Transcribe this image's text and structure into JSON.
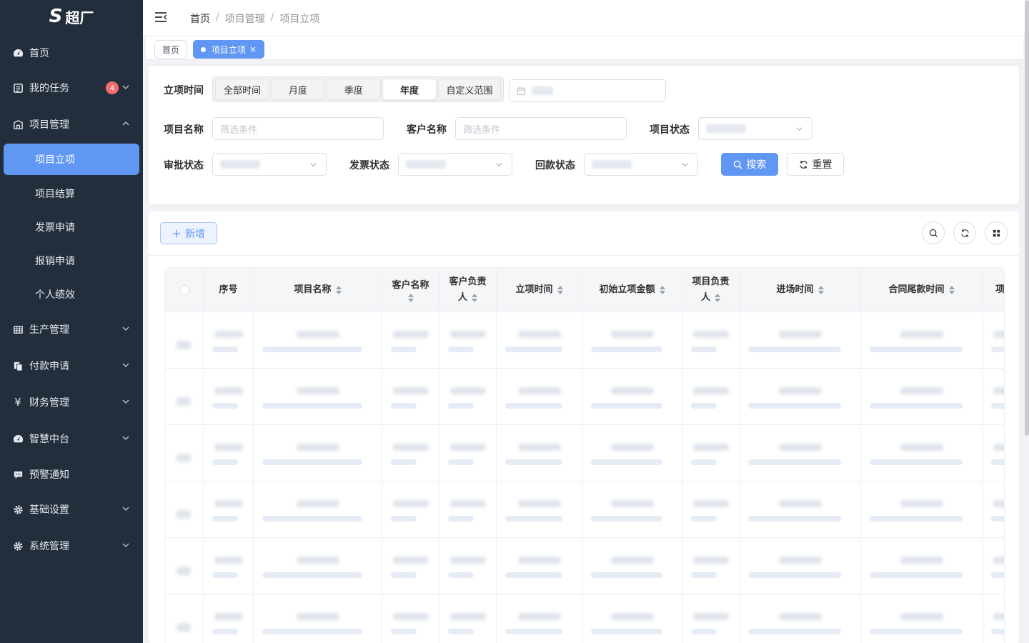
{
  "app": {
    "logo_text": "超厂"
  },
  "sidebar": {
    "items": [
      {
        "label": "首页",
        "icon": "dashboard-icon"
      },
      {
        "label": "我的任务",
        "icon": "task-icon",
        "badge": "4"
      },
      {
        "label": "项目管理",
        "icon": "project-icon",
        "expanded": true
      },
      {
        "label": "生产管理",
        "icon": "grid-icon"
      },
      {
        "label": "付款申请",
        "icon": "copy-icon"
      },
      {
        "label": "财务管理",
        "icon": "yen-icon"
      },
      {
        "label": "智慧中台",
        "icon": "dashboard-icon"
      },
      {
        "label": "预警通知",
        "icon": "message-icon"
      },
      {
        "label": "基础设置",
        "icon": "gear-icon"
      },
      {
        "label": "系统管理",
        "icon": "gear-icon"
      }
    ],
    "sub_items": [
      {
        "label": "项目立项",
        "active": true
      },
      {
        "label": "项目结算"
      },
      {
        "label": "发票申请"
      },
      {
        "label": "报销申请"
      },
      {
        "label": "个人绩效"
      }
    ]
  },
  "breadcrumb": [
    "首页",
    "项目管理",
    "项目立项"
  ],
  "breadcrumb_sep": "/",
  "tags": [
    {
      "label": "首页"
    },
    {
      "label": "项目立项",
      "active": true,
      "close": "×"
    }
  ],
  "filters": {
    "time_label": "立项时间",
    "time_options": [
      "全部时间",
      "月度",
      "季度",
      "年度",
      "自定义范围"
    ],
    "time_selected": "年度",
    "project_name_label": "项目名称",
    "project_name_placeholder": "筛选条件",
    "customer_name_label": "客户名称",
    "customer_name_placeholder": "筛选条件",
    "project_status_label": "项目状态",
    "approval_status_label": "审批状态",
    "invoice_status_label": "发票状态",
    "payment_status_label": "回款状态",
    "search_button": "搜索",
    "reset_button": "重置"
  },
  "toolbar": {
    "add_button": "新增"
  },
  "table": {
    "columns": [
      "序号",
      "项目名称",
      "客户名称",
      "客户负责人",
      "立项时间",
      "初始立项金额",
      "项目负责人",
      "进场时间",
      "合同尾款时间",
      "项"
    ],
    "loading_rows": 6
  },
  "colors": {
    "sidebar_bg": "#232e3c",
    "primary": "#5f97f3",
    "badge": "#f56c6c"
  }
}
